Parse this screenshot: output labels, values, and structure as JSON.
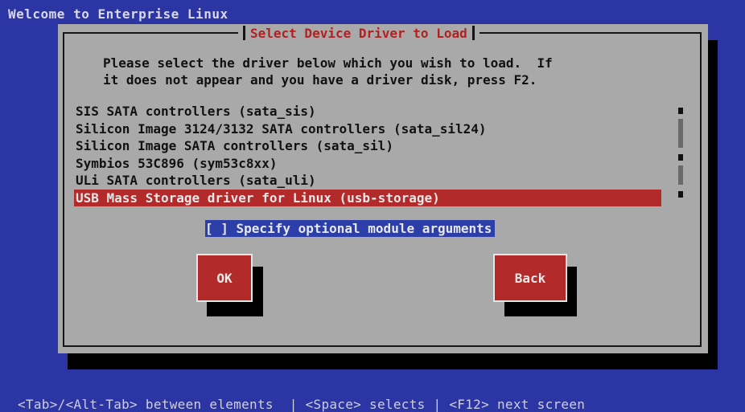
{
  "screen": {
    "title": "Welcome to Enterprise Linux"
  },
  "dialog": {
    "title": "Select Device Driver to Load",
    "instructions": [
      "Please select the driver below which you wish to load.  If",
      "it does not appear and you have a driver disk, press F2."
    ],
    "drivers": [
      {
        "label": "SIS SATA controllers (sata_sis)",
        "selected": false
      },
      {
        "label": "Silicon Image 3124/3132 SATA controllers (sata_sil24)",
        "selected": false
      },
      {
        "label": "Silicon Image SATA controllers (sata_sil)",
        "selected": false
      },
      {
        "label": "Symbios 53C896 (sym53c8xx)",
        "selected": false
      },
      {
        "label": "ULi SATA controllers (sata_uli)",
        "selected": false
      },
      {
        "label": "USB Mass Storage driver for Linux (usb-storage)",
        "selected": true
      }
    ],
    "checkbox_label": "[ ] Specify optional module arguments",
    "ok_label": "OK",
    "back_label": "Back"
  },
  "footer": {
    "hint": "<Tab>/<Alt-Tab> between elements  | <Space> selects | <F12> next screen"
  },
  "colors": {
    "background": "#2b35a3",
    "dialog": "#a9a9a9",
    "accent_red": "#b32a2a",
    "focus_blue": "#2c3fa8"
  }
}
